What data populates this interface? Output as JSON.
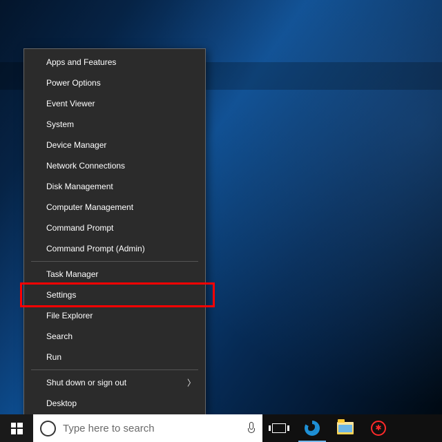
{
  "context_menu": {
    "group1": [
      {
        "label": "Apps and Features"
      },
      {
        "label": "Power Options"
      },
      {
        "label": "Event Viewer"
      },
      {
        "label": "System"
      },
      {
        "label": "Device Manager"
      },
      {
        "label": "Network Connections"
      },
      {
        "label": "Disk Management"
      },
      {
        "label": "Computer Management"
      },
      {
        "label": "Command Prompt"
      },
      {
        "label": "Command Prompt (Admin)"
      }
    ],
    "group2": [
      {
        "label": "Task Manager"
      },
      {
        "label": "Settings",
        "highlighted": true
      },
      {
        "label": "File Explorer"
      },
      {
        "label": "Search"
      },
      {
        "label": "Run"
      }
    ],
    "group3": [
      {
        "label": "Shut down or sign out",
        "submenu": true
      },
      {
        "label": "Desktop"
      }
    ]
  },
  "taskbar": {
    "search_placeholder": "Type here to search"
  }
}
